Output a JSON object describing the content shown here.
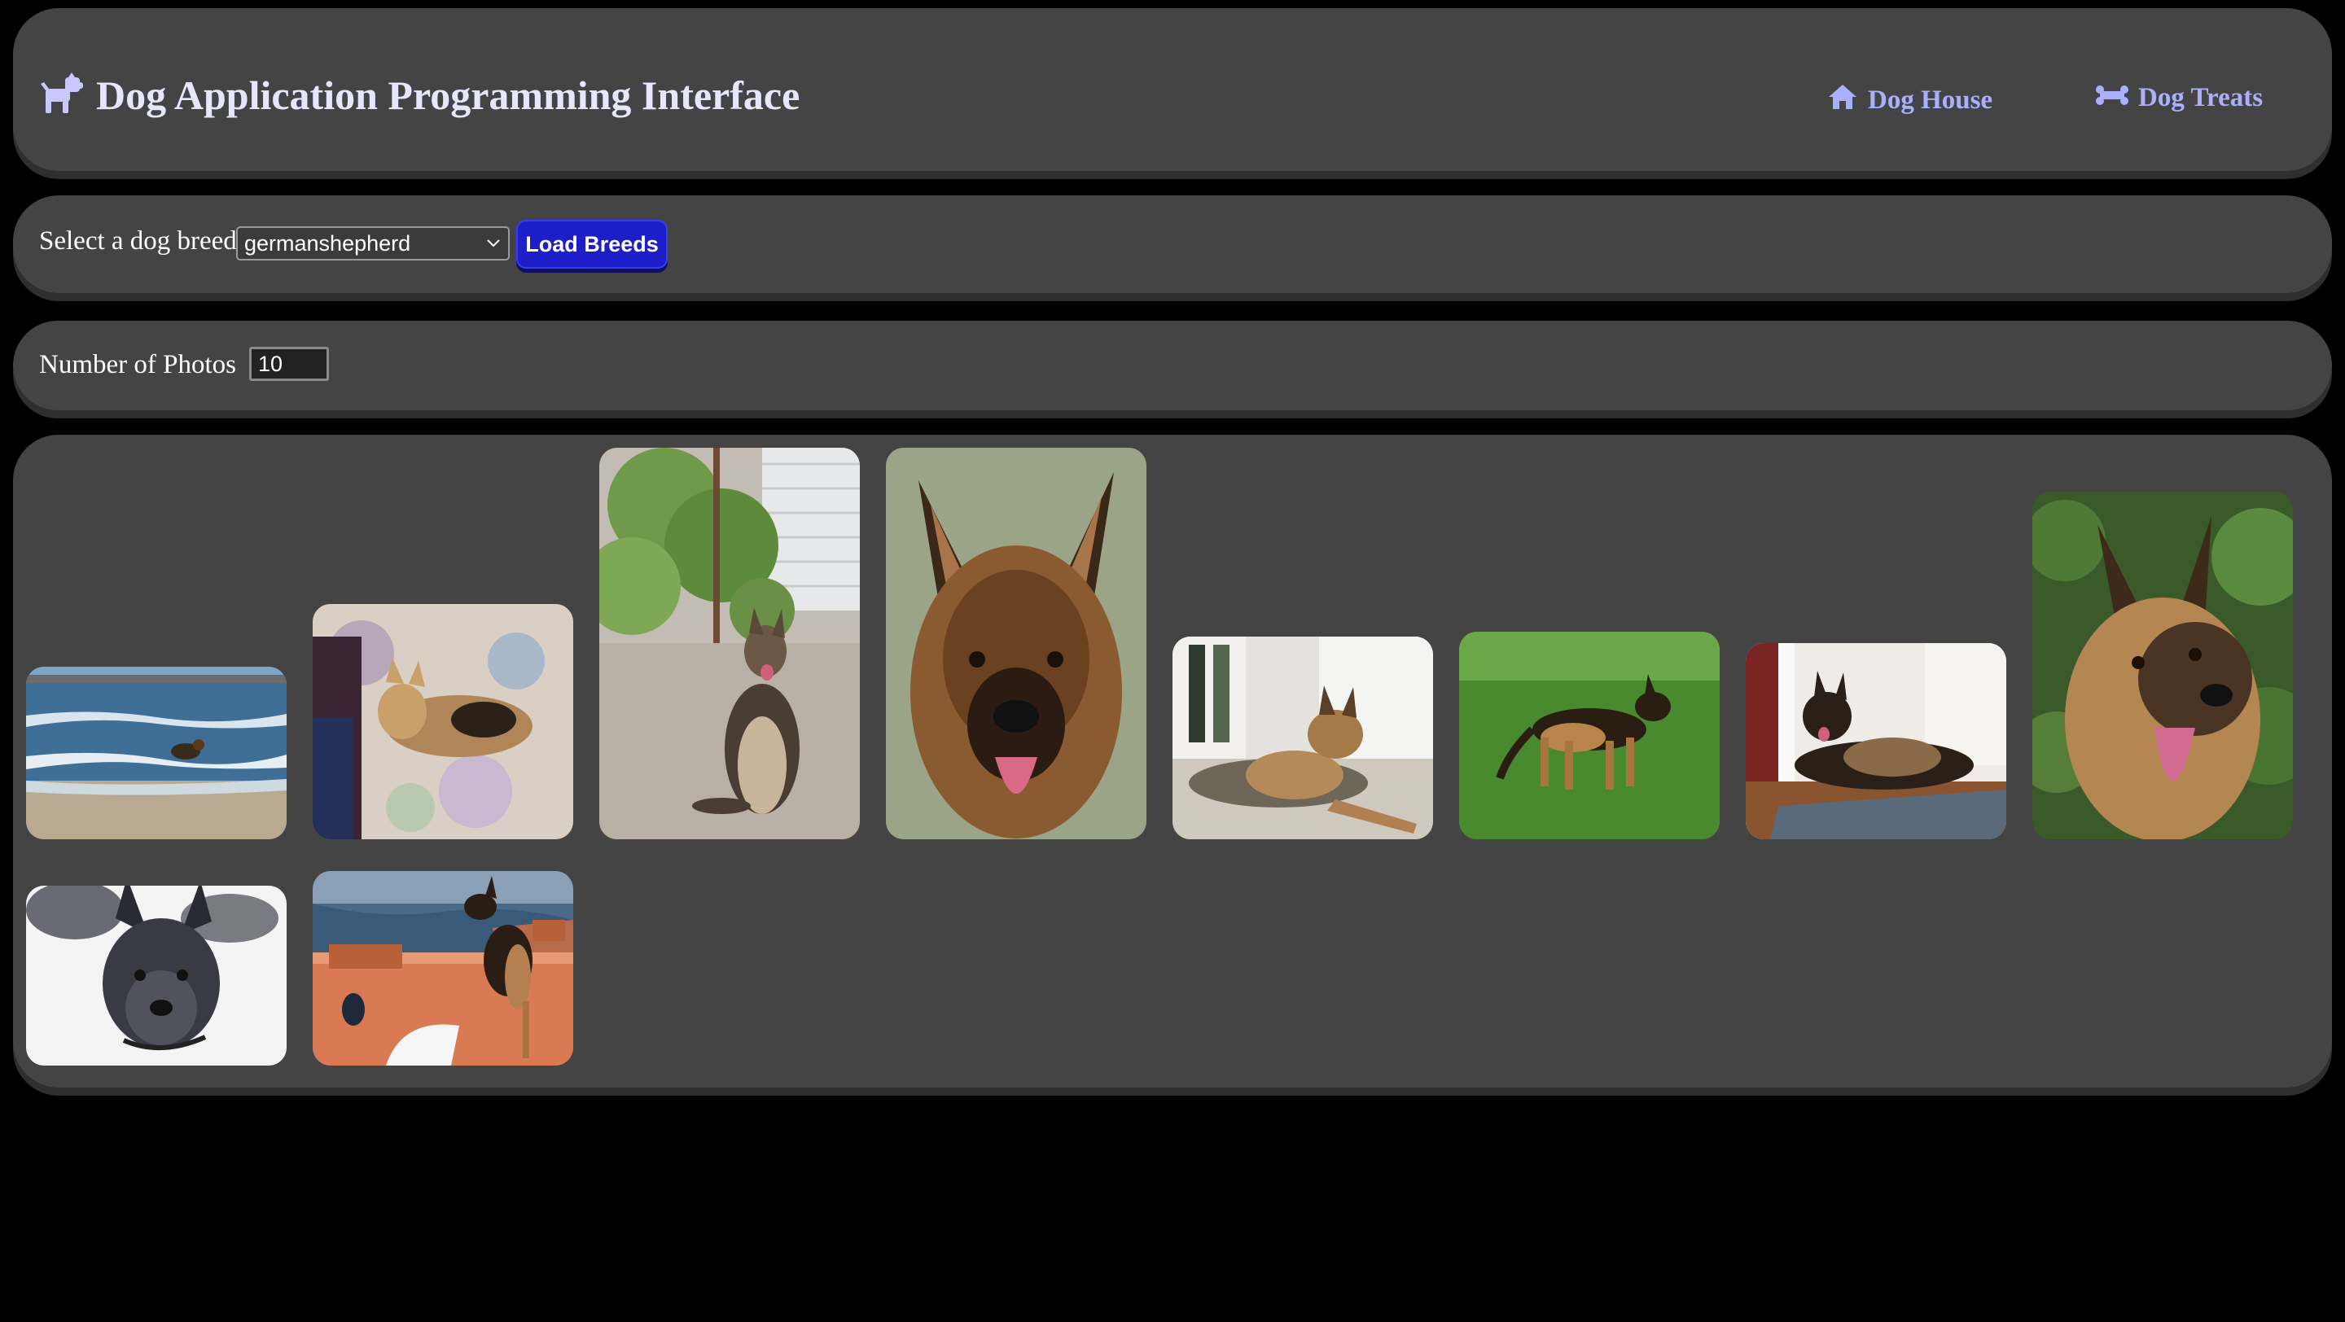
{
  "header": {
    "title": "Dog Application Programming Interface",
    "logo_icon": "dog-icon",
    "nav": [
      {
        "label": "Dog House",
        "icon": "house-icon"
      },
      {
        "label": "Dog Treats",
        "icon": "bone-icon"
      }
    ]
  },
  "breed_form": {
    "label": "Select a dog breed",
    "selected_breed": "germanshepherd",
    "load_button": "Load Breeds"
  },
  "photos_form": {
    "label": "Number of Photos",
    "value": "10"
  },
  "colors": {
    "panel": "#444444",
    "background": "#000000",
    "nav_link": "#aab0ff",
    "button": "#1e1ec8"
  }
}
